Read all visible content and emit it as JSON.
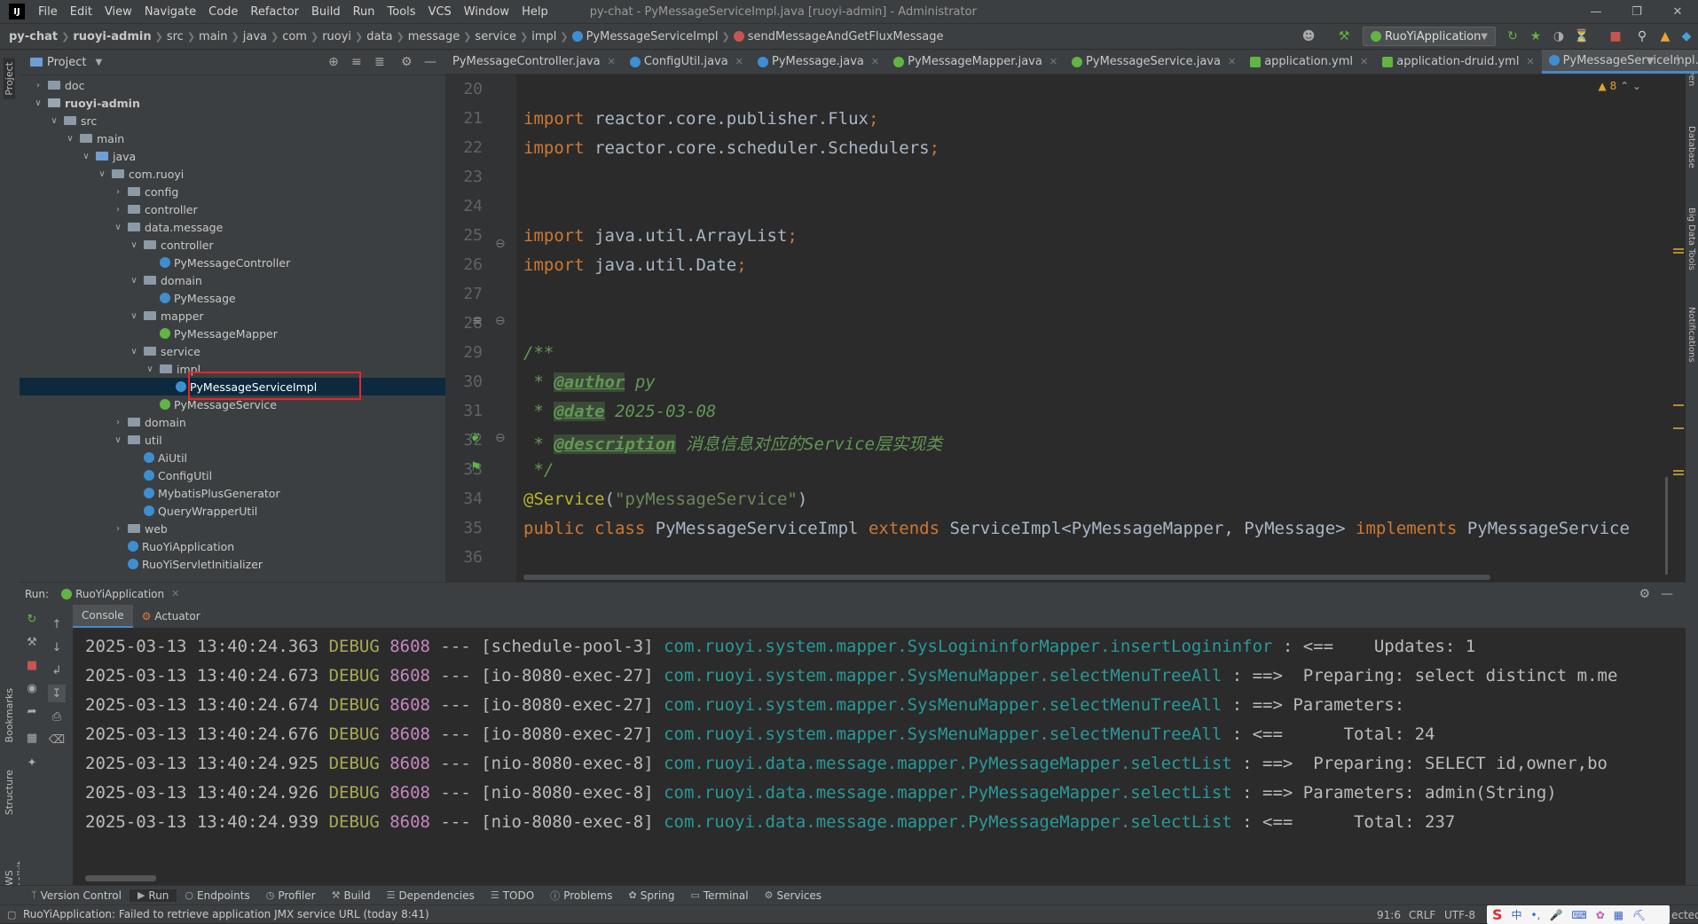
{
  "menu": [
    "File",
    "Edit",
    "View",
    "Navigate",
    "Code",
    "Refactor",
    "Build",
    "Run",
    "Tools",
    "VCS",
    "Window",
    "Help"
  ],
  "window_title": "py-chat - PyMessageServiceImpl.java [ruoyi-admin] - Administrator",
  "breadcrumbs": [
    "py-chat",
    "ruoyi-admin",
    "src",
    "main",
    "java",
    "com",
    "ruoyi",
    "data",
    "message",
    "service",
    "impl",
    "PyMessageServiceImpl",
    "sendMessageAndGetFluxMessage"
  ],
  "run_config": "RuoYiApplication",
  "project_panel": {
    "title": "Project",
    "tree": [
      {
        "label": "doc",
        "depth": 1,
        "arrow": ">",
        "icon": "folder"
      },
      {
        "label": "ruoyi-admin",
        "depth": 1,
        "arrow": "v",
        "icon": "module",
        "bold": true
      },
      {
        "label": "src",
        "depth": 2,
        "arrow": "v",
        "icon": "folder"
      },
      {
        "label": "main",
        "depth": 3,
        "arrow": "v",
        "icon": "folder"
      },
      {
        "label": "java",
        "depth": 4,
        "arrow": "v",
        "icon": "folder-blue"
      },
      {
        "label": "com.ruoyi",
        "depth": 5,
        "arrow": "v",
        "icon": "package"
      },
      {
        "label": "config",
        "depth": 6,
        "arrow": ">",
        "icon": "package"
      },
      {
        "label": "controller",
        "depth": 6,
        "arrow": ">",
        "icon": "package"
      },
      {
        "label": "data.message",
        "depth": 6,
        "arrow": "v",
        "icon": "package"
      },
      {
        "label": "controller",
        "depth": 7,
        "arrow": "v",
        "icon": "package"
      },
      {
        "label": "PyMessageController",
        "depth": 8,
        "arrow": "",
        "icon": "class"
      },
      {
        "label": "domain",
        "depth": 7,
        "arrow": "v",
        "icon": "package"
      },
      {
        "label": "PyMessage",
        "depth": 8,
        "arrow": "",
        "icon": "class"
      },
      {
        "label": "mapper",
        "depth": 7,
        "arrow": "v",
        "icon": "package"
      },
      {
        "label": "PyMessageMapper",
        "depth": 8,
        "arrow": "",
        "icon": "interface"
      },
      {
        "label": "service",
        "depth": 7,
        "arrow": "v",
        "icon": "package"
      },
      {
        "label": "impl",
        "depth": 8,
        "arrow": "v",
        "icon": "package"
      },
      {
        "label": "PyMessageServiceImpl",
        "depth": 9,
        "arrow": "",
        "icon": "class",
        "selected": true
      },
      {
        "label": "PyMessageService",
        "depth": 8,
        "arrow": "",
        "icon": "interface"
      },
      {
        "label": "domain",
        "depth": 6,
        "arrow": ">",
        "icon": "package"
      },
      {
        "label": "util",
        "depth": 6,
        "arrow": "v",
        "icon": "package"
      },
      {
        "label": "AiUtil",
        "depth": 7,
        "arrow": "",
        "icon": "class"
      },
      {
        "label": "ConfigUtil",
        "depth": 7,
        "arrow": "",
        "icon": "class"
      },
      {
        "label": "MybatisPlusGenerator",
        "depth": 7,
        "arrow": "",
        "icon": "class"
      },
      {
        "label": "QueryWrapperUtil",
        "depth": 7,
        "arrow": "",
        "icon": "class"
      },
      {
        "label": "web",
        "depth": 6,
        "arrow": ">",
        "icon": "package"
      },
      {
        "label": "RuoYiApplication",
        "depth": 6,
        "arrow": "",
        "icon": "app"
      },
      {
        "label": "RuoYiServletInitializer",
        "depth": 6,
        "arrow": "",
        "icon": "class"
      }
    ]
  },
  "editor_tabs": [
    {
      "label": "PyMessageController.java",
      "icon": "none"
    },
    {
      "label": "ConfigUtil.java",
      "icon": "class"
    },
    {
      "label": "PyMessage.java",
      "icon": "class"
    },
    {
      "label": "PyMessageMapper.java",
      "icon": "interface"
    },
    {
      "label": "PyMessageService.java",
      "icon": "interface"
    },
    {
      "label": "application.yml",
      "icon": "yml"
    },
    {
      "label": "application-druid.yml",
      "icon": "yml"
    },
    {
      "label": "PyMessageServiceImpl.java",
      "icon": "class",
      "active": true
    }
  ],
  "editor": {
    "warnings": "8",
    "line_numbers": [
      "20",
      "21",
      "22",
      "23",
      "24",
      "25",
      "26",
      "27",
      "28",
      "29",
      "30",
      "31",
      "32",
      "33",
      "34",
      "35",
      "36"
    ],
    "imports": {
      "l21": "reactor.core.publisher.Flux",
      "l22": "reactor.core.scheduler.Schedulers",
      "l26": "java.util.ArrayList",
      "l27": "java.util.Date"
    },
    "kw_import": "import",
    "doc_open": "/**",
    "doc_author_tag": "@author",
    "doc_author_val": " py",
    "doc_date_tag": "@date",
    "doc_date_val": " 2025-03-08",
    "doc_desc_tag": "@description",
    "doc_desc_val": " 消息信息对应的Service层实现类",
    "doc_close": "*/",
    "annotation": "@Service",
    "annotation_arg": "\"pyMessageService\"",
    "class_decl": {
      "mods": "public class",
      "name": " PyMessageServiceImpl ",
      "extends_kw": "extends",
      "base": " ServiceImpl<PyMessageMapper, PyMessage> ",
      "implements_kw": "implements",
      "iface": " PyMessageService"
    }
  },
  "run_panel": {
    "label": "Run:",
    "tab": "RuoYiApplication",
    "subtabs": [
      "Console",
      "Actuator"
    ],
    "log_lines": [
      {
        "ts": "2025-03-13 13:40:24.363",
        "level": "DEBUG",
        "pid": "8608",
        "thread": "[schedule-pool-3]",
        "logger": "com.ruoyi.system.mapper.SysLogininforMapper.insertLogininfor",
        "msg": " : <==    Updates: 1"
      },
      {
        "ts": "2025-03-13 13:40:24.673",
        "level": "DEBUG",
        "pid": "8608",
        "thread": "[io-8080-exec-27]",
        "logger": "com.ruoyi.system.mapper.SysMenuMapper.selectMenuTreeAll",
        "msg": " : ==>  Preparing: select distinct m.me"
      },
      {
        "ts": "2025-03-13 13:40:24.674",
        "level": "DEBUG",
        "pid": "8608",
        "thread": "[io-8080-exec-27]",
        "logger": "com.ruoyi.system.mapper.SysMenuMapper.selectMenuTreeAll",
        "msg": " : ==> Parameters:"
      },
      {
        "ts": "2025-03-13 13:40:24.676",
        "level": "DEBUG",
        "pid": "8608",
        "thread": "[io-8080-exec-27]",
        "logger": "com.ruoyi.system.mapper.SysMenuMapper.selectMenuTreeAll",
        "msg": " : <==      Total: 24"
      },
      {
        "ts": "2025-03-13 13:40:24.925",
        "level": "DEBUG",
        "pid": "8608",
        "thread": "[nio-8080-exec-8]",
        "logger": "com.ruoyi.data.message.mapper.PyMessageMapper.selectList",
        "msg": " : ==>  Preparing: SELECT id,owner,bo"
      },
      {
        "ts": "2025-03-13 13:40:24.926",
        "level": "DEBUG",
        "pid": "8608",
        "thread": "[nio-8080-exec-8]",
        "logger": "com.ruoyi.data.message.mapper.PyMessageMapper.selectList",
        "msg": " : ==> Parameters: admin(String)"
      },
      {
        "ts": "2025-03-13 13:40:24.939",
        "level": "DEBUG",
        "pid": "8608",
        "thread": "[nio-8080-exec-8]",
        "logger": "com.ruoyi.data.message.mapper.PyMessageMapper.selectList",
        "msg": " : <==      Total: 237"
      }
    ]
  },
  "bottom_tools": [
    "Version Control",
    "Run",
    "Endpoints",
    "Profiler",
    "Build",
    "Dependencies",
    "TODO",
    "Problems",
    "Spring",
    "Terminal",
    "Services"
  ],
  "left_strip": [
    "Project",
    "Bookmarks",
    "Structure",
    "AWS Toolkit"
  ],
  "right_strip": [
    "Maven",
    "Database",
    "Big Data Tools",
    "Notifications"
  ],
  "status": {
    "message": "RuoYiApplication: Failed to retrieve application JMX service URL (today 8:41)",
    "position": "91:6",
    "line_sep": "CRLF",
    "encoding": "UTF-8",
    "tail": "ected"
  },
  "colors": {
    "accent": "#4a88c7",
    "selection_box": "#e8262d"
  }
}
